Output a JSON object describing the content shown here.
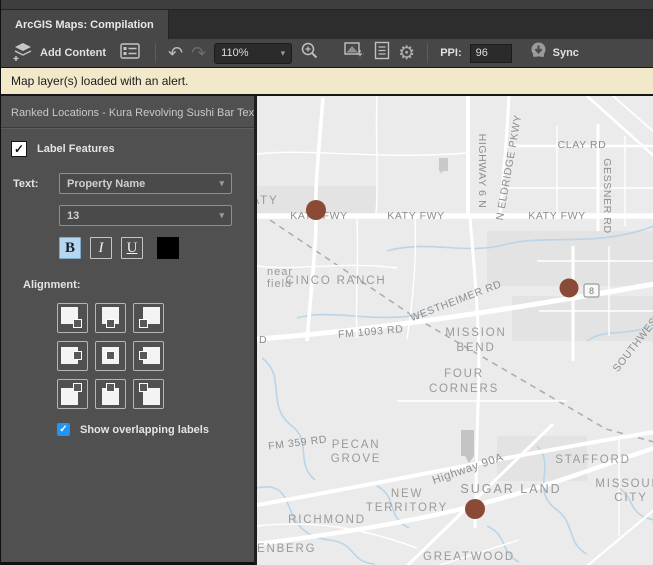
{
  "window": {
    "tab_title": "ArcGIS Maps: Compilation"
  },
  "toolbar": {
    "add_content_label": "Add Content",
    "zoom_value": "110%",
    "ppi_label": "PPI:",
    "ppi_value": "96",
    "sync_label": "Sync",
    "icons": {
      "add_content": "layers-plus",
      "legend": "legend-table",
      "undo": "↶",
      "redo": "↷",
      "zoom_in": "magnifier-plus",
      "artboard_export": "image-crosshair",
      "report": "document-lines",
      "settings": "gear",
      "sync": "down-arrow-circle",
      "dropdown_chevron": "▾",
      "gear_glyph": "⚙"
    }
  },
  "notification": {
    "message": "Map layer(s) loaded with an alert."
  },
  "panel": {
    "title": "Ranked Locations - Kura Revolving Sushi Bar Texas_",
    "label_features": {
      "label": "Label Features",
      "checked": true,
      "check_glyph": "✓"
    },
    "text_label": "Text:",
    "text_field_value": "Property Name",
    "font_size_value": "13",
    "style_buttons": {
      "bold": "B",
      "italic": "I",
      "underline": "U",
      "bold_active": true,
      "color_swatch": "#000000"
    },
    "alignment_label": "Alignment:",
    "alignment_options": [
      "above-left",
      "above-center",
      "above-right",
      "center-left",
      "center",
      "center-right",
      "below-left",
      "below-center",
      "below-right"
    ],
    "show_overlapping": {
      "label": "Show overlapping labels",
      "checked": true,
      "check_glyph": "✓"
    }
  },
  "map": {
    "background": "#ebebeb",
    "road_color": "#ffffff",
    "water_color": "#b9d5e7",
    "city_label_color": "#9a9a9a",
    "road_label_color": "#8d8d8d",
    "marker_color": "#8a4a35",
    "marker_count": 3,
    "badge_value": "8",
    "labels": {
      "katy_cut": "ATY",
      "katy_fwy": "KATY FWY",
      "highway_6": "HIGHWAY 6 N",
      "eldridge": "N ELDRIDGE PKWY",
      "clay_rd": "CLAY RD",
      "gessner": "GESSNER RD",
      "near_cut": "near",
      "field_cut": "field",
      "cinco_ranch": "CINCO RANCH",
      "westheimer": "WESTHEIMER RD",
      "southwest": "SOUTHWEST",
      "fm_1093": "FM 1093 RD",
      "d_cut": "D",
      "mission_1": "MISSION",
      "mission_2": "BEND",
      "four_1": "FOUR",
      "four_2": "CORNERS",
      "fm_359": "FM 359 RD",
      "pecan_1": "PECAN",
      "pecan_2": "GROVE",
      "highway_90a": "Highway 90A",
      "new_1": "NEW",
      "new_2": "TERRITORY",
      "sugar_land": "SUGAR LAND",
      "stafford": "STAFFORD",
      "missouri_1": "MISSOURI",
      "missouri_2": "CITY",
      "richmond": "RICHMOND",
      "enberg_cut": "ENBERG",
      "greatwood": "GREATWOOD"
    }
  }
}
